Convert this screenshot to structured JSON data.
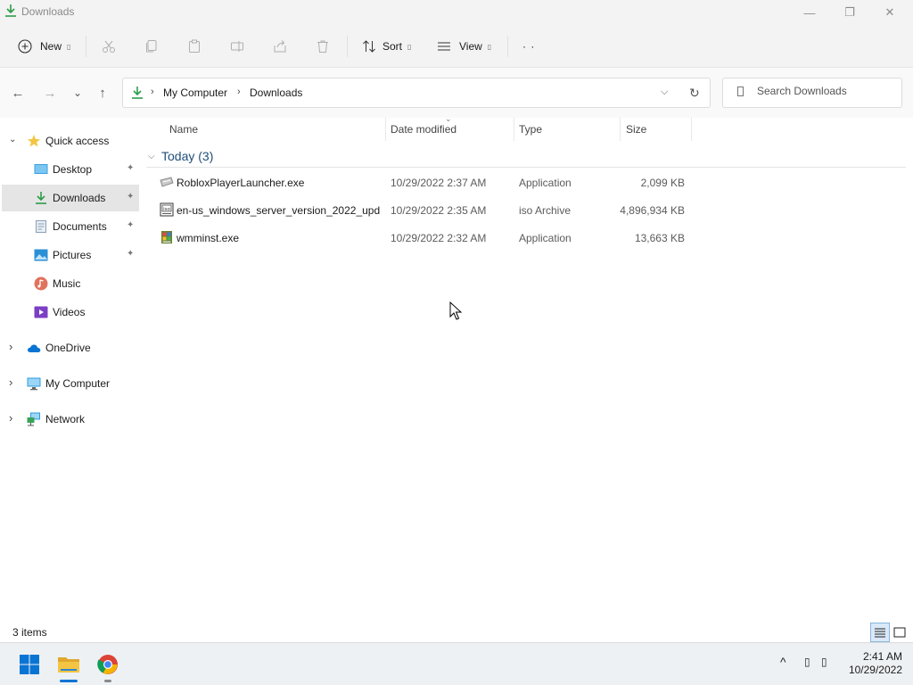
{
  "window": {
    "title": "Downloads",
    "controls": {
      "minimize": "—",
      "maximize": "❐",
      "close": "✕"
    }
  },
  "commandbar": {
    "new_label": "New",
    "sort_label": "Sort",
    "view_label": "View",
    "more": "· ·",
    "dropdown_mark": "▯"
  },
  "address": {
    "separator": "›",
    "crumbs": [
      "My Computer",
      "Downloads"
    ],
    "dropdown": "⌵",
    "refresh": "↻"
  },
  "search": {
    "placeholder": "Search Downloads"
  },
  "nav": {
    "back": "←",
    "forward": "→",
    "recent": "⌄",
    "up": "↑"
  },
  "sidebar": {
    "expand_open": "⌄",
    "expand_closed": "›",
    "pin": "📌",
    "quick_access": "Quick access",
    "items": [
      {
        "label": "Desktop",
        "pinned": true
      },
      {
        "label": "Downloads",
        "pinned": true,
        "selected": true
      },
      {
        "label": "Documents",
        "pinned": true
      },
      {
        "label": "Pictures",
        "pinned": true
      },
      {
        "label": "Music",
        "pinned": false
      },
      {
        "label": "Videos",
        "pinned": false
      }
    ],
    "roots": [
      "OneDrive",
      "My Computer",
      "Network"
    ]
  },
  "columns": {
    "name": "Name",
    "date": "Date modified",
    "type": "Type",
    "size": "Size",
    "sort_indicator": "⌄"
  },
  "group": {
    "chevron": "⌵",
    "label": "Today (3)"
  },
  "files": [
    {
      "name": "RobloxPlayerLauncher.exe",
      "date": "10/29/2022 2:37 AM",
      "type": "Application",
      "size": "2,099 KB",
      "icon": "roblox-installer-icon"
    },
    {
      "name": "en-us_windows_server_version_2022_upd...",
      "date": "10/29/2022 2:35 AM",
      "type": "iso Archive",
      "size": "4,896,934 KB",
      "icon": "iso-archive-icon"
    },
    {
      "name": "wmminst.exe",
      "date": "10/29/2022 2:32 AM",
      "type": "Application",
      "size": "13,663 KB",
      "icon": "installer-icon"
    }
  ],
  "status": {
    "item_count": "3 items"
  },
  "taskbar": {
    "tray_chevron": "^",
    "tray_box": "▯",
    "time": "2:41 AM",
    "date": "10/29/2022"
  },
  "colors": {
    "accent": "#0078d4",
    "download_green": "#2e9c4a",
    "folder_yellow": "#f4c542",
    "selection_gray": "#e5e5e5"
  }
}
